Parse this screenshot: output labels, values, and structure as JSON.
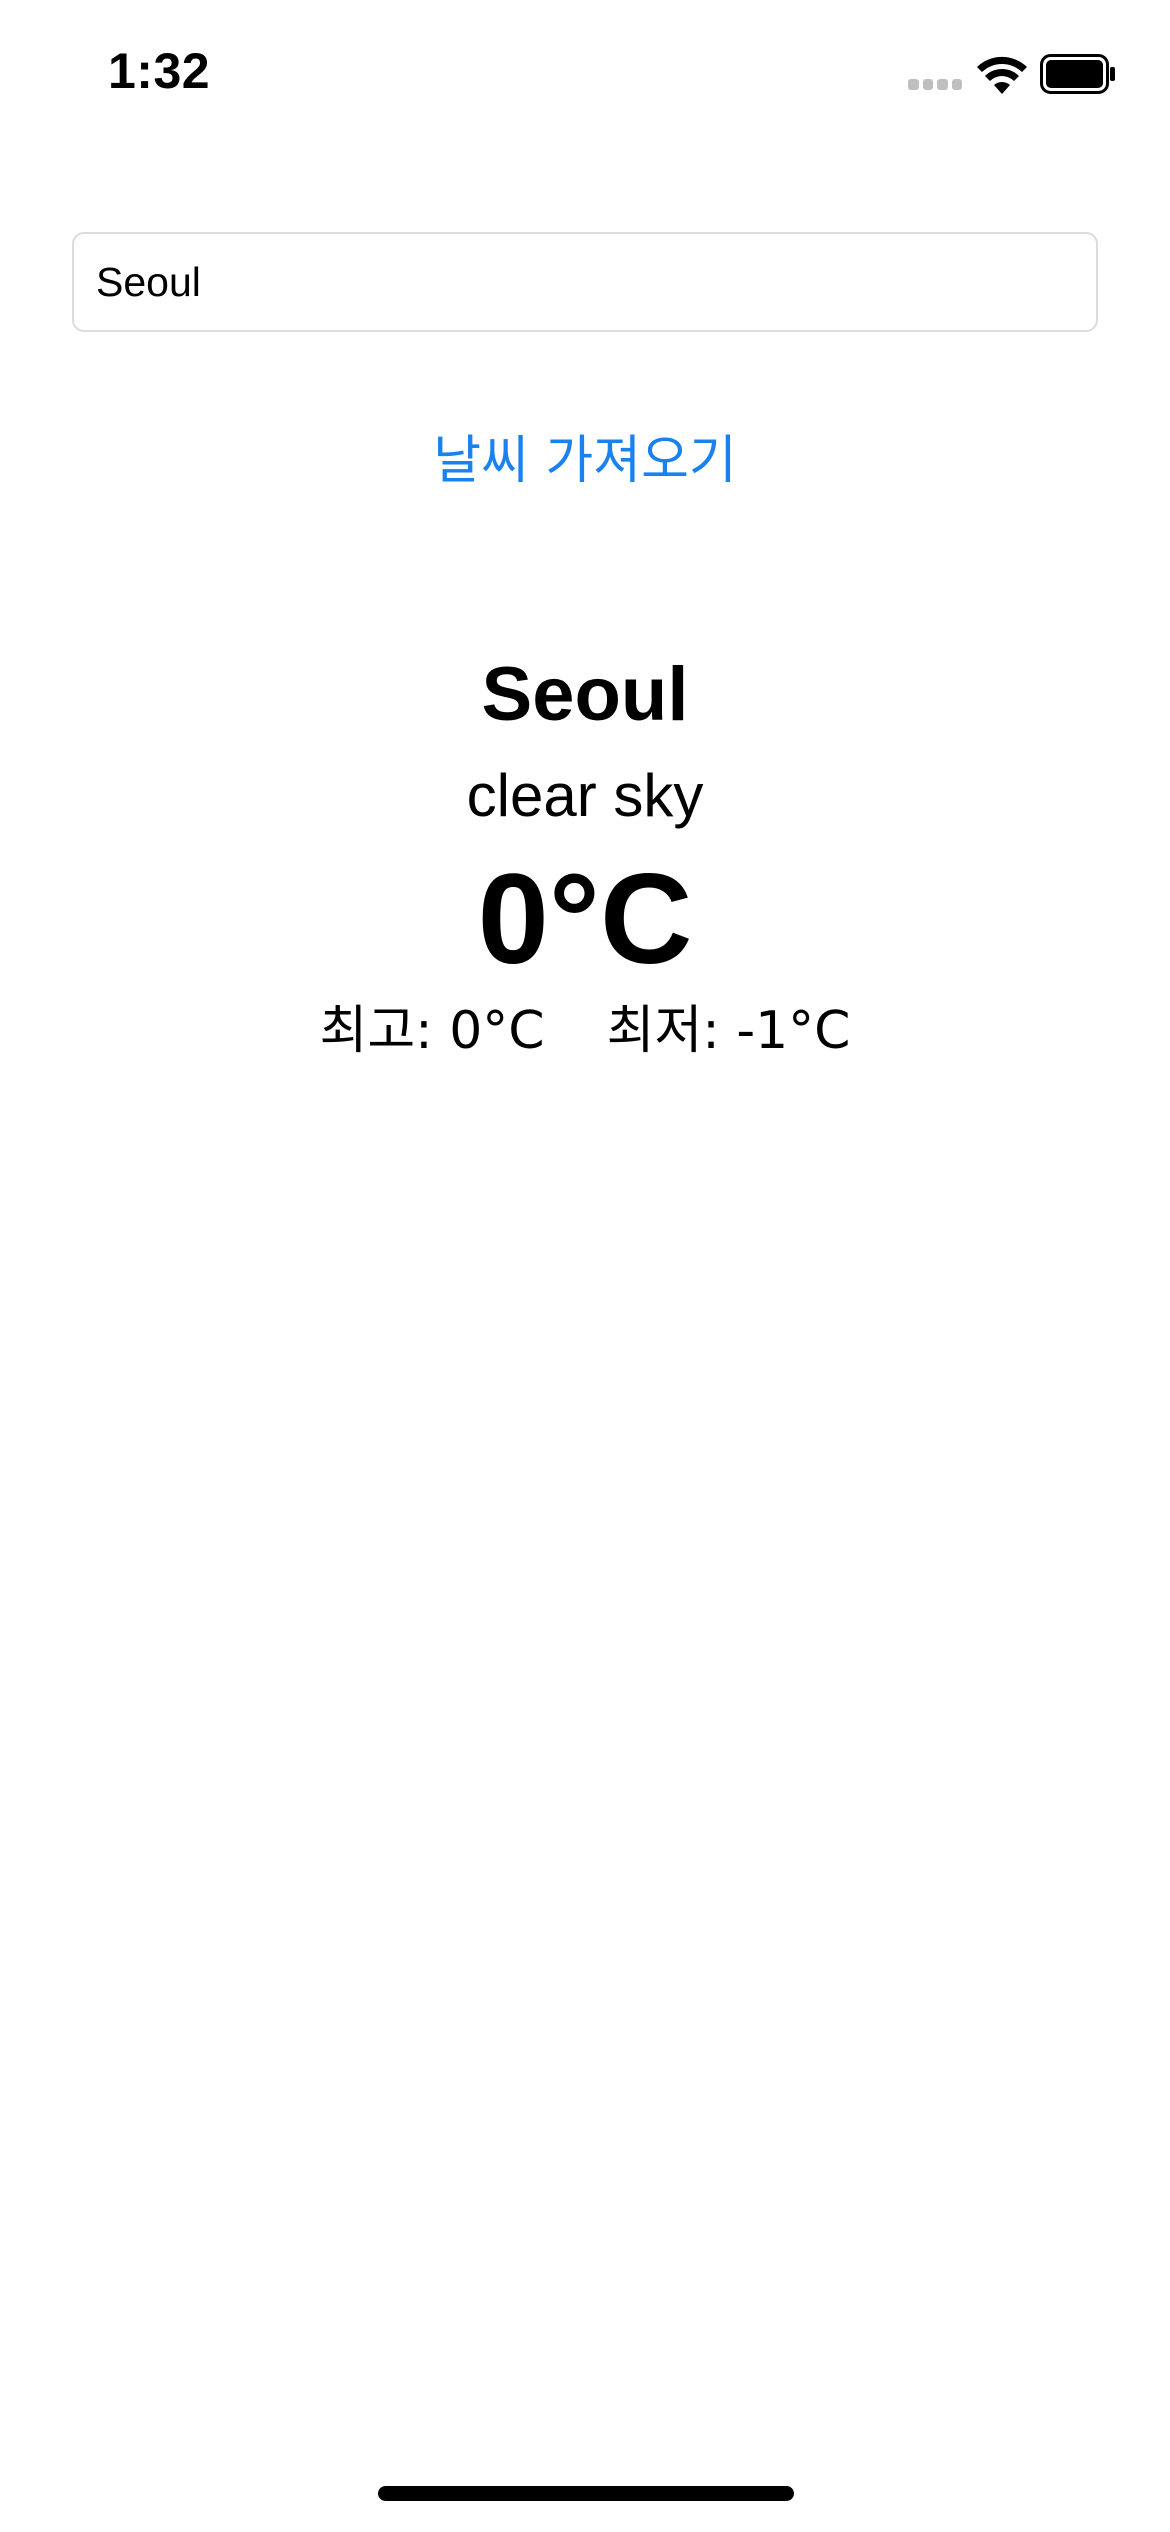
{
  "status_bar": {
    "time": "1:32",
    "icons": [
      "cell-signal-icon",
      "wifi-icon",
      "battery-icon"
    ]
  },
  "search": {
    "value": "Seoul",
    "placeholder": ""
  },
  "fetch_button": {
    "label": "날씨 가져오기",
    "color": "#1a82ef"
  },
  "weather": {
    "city": "Seoul",
    "description": "clear sky",
    "temperature": "0°C",
    "high": "최고: 0°C",
    "low": "최저: -1°C"
  }
}
